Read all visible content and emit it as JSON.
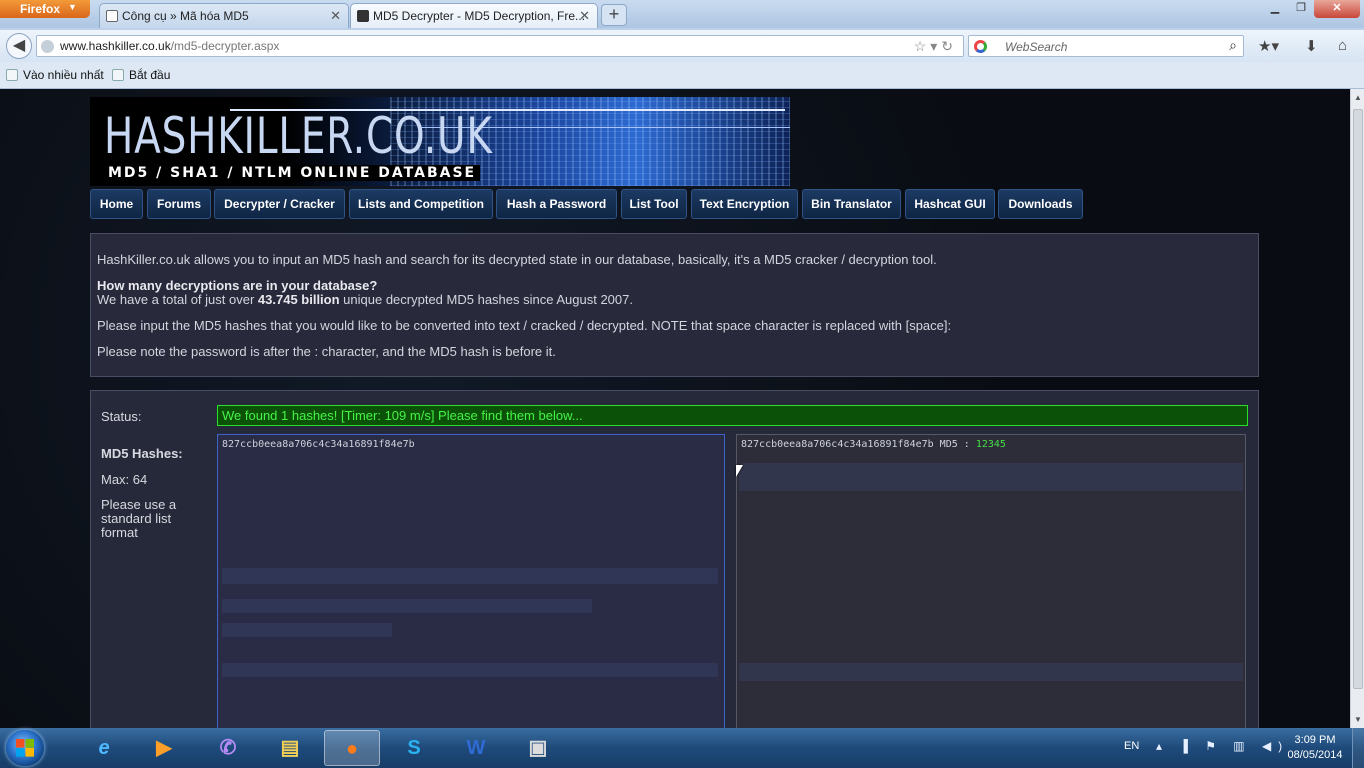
{
  "browser": {
    "menu_button": "Firefox",
    "tabs": [
      {
        "title": "Công cụ » Mã hóa MD5"
      },
      {
        "title": "MD5 Decrypter - MD5 Decryption, Fre..."
      }
    ],
    "url_host": "www.hashkiller.co.uk",
    "url_path": "/md5-decrypter.aspx",
    "search_placeholder": "WebSearch",
    "bookmarks": [
      "Vào nhiều nhất",
      "Bắt đầu"
    ]
  },
  "site": {
    "logo": "HASHKILLER.CO.UK",
    "tagline": "MD5 / SHA1 / NTLM ONLINE DATABASE",
    "menu": [
      "Home",
      "Forums",
      "Decrypter / Cracker",
      "Lists and Competition",
      "Hash a Password",
      "List Tool",
      "Text Encryption",
      "Bin Translator",
      "Hashcat GUI",
      "Downloads"
    ]
  },
  "info": {
    "intro": "HashKiller.co.uk allows you to input an MD5 hash and search for its decrypted state in our database, basically, it's a MD5 cracker / decryption tool.",
    "question": "How many decryptions are in your database?",
    "total_pre": "We have a total of just over ",
    "total_value": "43.745 billion",
    "total_post": " unique decrypted MD5 hashes since August 2007.",
    "instruction": "Please input the MD5 hashes that you would like to be converted into text / cracked / decrypted. NOTE that space character is replaced with [space]:",
    "note": "Please note the password is after the : character, and the MD5 hash is before it."
  },
  "form": {
    "status_label": "Status:",
    "status_message": "We found 1 hashes! [Timer: 109 m/s] Please find them below...",
    "hashes_label": "MD5 Hashes:",
    "max_label": "Max: 64",
    "format_hint": "Please use a standard list format",
    "input_value": "827ccb0eea8a706c4c34a16891f84e7b",
    "output_hash": "827ccb0eea8a706c4c34a16891f84e7b MD5 : ",
    "output_plain": "12345"
  },
  "taskbar": {
    "lang": "EN",
    "time": "3:09 PM",
    "date": "08/05/2014"
  },
  "colors": {
    "status_bg": "#0b5208",
    "status_text": "#46f246",
    "panel_bg": "#282a3c",
    "menu_bg": "#1c3a63"
  }
}
